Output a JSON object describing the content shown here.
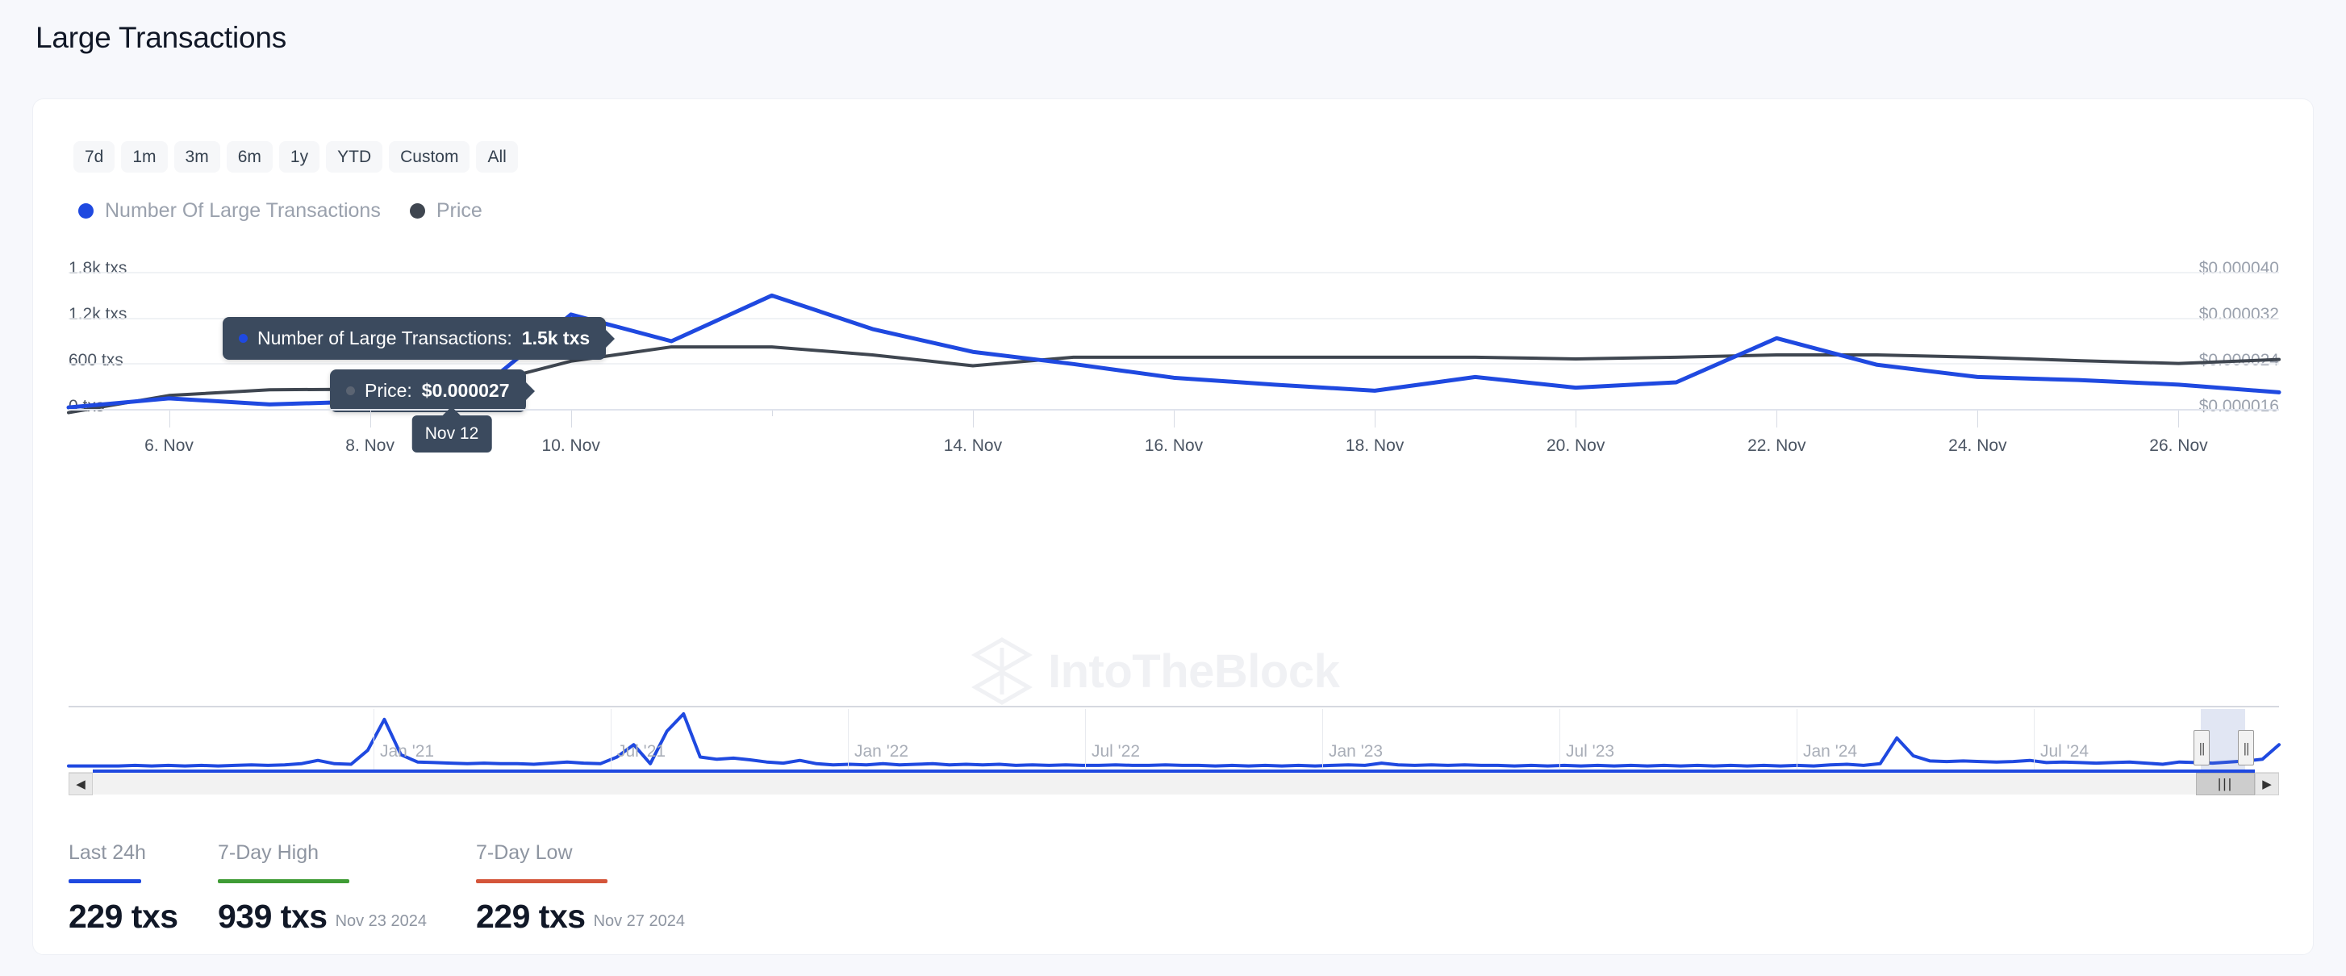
{
  "page_title": "Large Transactions",
  "ranges": [
    {
      "label": "7d",
      "selected": false
    },
    {
      "label": "1m",
      "selected": false
    },
    {
      "label": "3m",
      "selected": false
    },
    {
      "label": "6m",
      "selected": false
    },
    {
      "label": "1y",
      "selected": false
    },
    {
      "label": "YTD",
      "selected": false
    },
    {
      "label": "Custom",
      "selected": false
    },
    {
      "label": "All",
      "selected": false
    }
  ],
  "legend": [
    {
      "label": "Number Of Large Transactions",
      "color": "#1f49e0"
    },
    {
      "label": "Price",
      "color": "#3f4650"
    }
  ],
  "watermark": "IntoTheBlock",
  "tooltips": {
    "series_tip": {
      "prefix": "Number of Large Transactions: ",
      "value": "1.5k txs",
      "color": "#1f49e0"
    },
    "price_tip": {
      "prefix": "Price: ",
      "value": "$0.000027",
      "color": "#3f4650"
    },
    "x_bubble": "Nov 12"
  },
  "stats": [
    {
      "title": "Last 24h",
      "color": "#1f49e0",
      "value": "229 txs",
      "date": ""
    },
    {
      "title": "7-Day High",
      "color": "#3f9c35",
      "value": "939 txs",
      "date": "Nov 23 2024"
    },
    {
      "title": "7-Day Low",
      "color": "#d4553a",
      "value": "229 txs",
      "date": "Nov 27 2024"
    }
  ],
  "navigator": {
    "tick_labels": [
      "Jan '21",
      "Jul '21",
      "Jan '22",
      "Jul '22",
      "Jan '23",
      "Jul '23",
      "Jan '24",
      "Jul '24"
    ],
    "scroll_left_icon": "◀",
    "scroll_right_icon": "▶",
    "thumb_grip": "|||",
    "handle_grip": "||"
  },
  "chart_data": {
    "type": "line",
    "title": "Large Transactions",
    "xlabel": "",
    "ylabel": "txs",
    "y_left_ticks": [
      "0 txs",
      "600 txs",
      "1.2k txs",
      "1.8k txs"
    ],
    "y_left_values": [
      0,
      600,
      1200,
      1800
    ],
    "ylim": [
      0,
      1900
    ],
    "y_right_ticks": [
      "$0.000016",
      "$0.000024",
      "$0.000032",
      "$0.000040"
    ],
    "y_right_values": [
      1.6e-05,
      2.4e-05,
      3.2e-05,
      4e-05
    ],
    "y2lim": [
      1.35e-05,
      4.25e-05
    ],
    "x_tick_labels": [
      "6. Nov",
      "8. Nov",
      "10. Nov",
      "14. Nov",
      "16. Nov",
      "18. Nov",
      "20. Nov",
      "22. Nov",
      "24. Nov",
      "26. Nov"
    ],
    "grid": true,
    "legend_position": "top-left",
    "x": [
      "5. Nov",
      "6. Nov",
      "7. Nov",
      "8. Nov",
      "9. Nov",
      "10. Nov",
      "11. Nov",
      "12. Nov",
      "13. Nov",
      "14. Nov",
      "15. Nov",
      "16. Nov",
      "17. Nov",
      "18. Nov",
      "19. Nov",
      "20. Nov",
      "21. Nov",
      "22. Nov",
      "23. Nov",
      "24. Nov",
      "25. Nov",
      "26. Nov",
      "27. Nov"
    ],
    "series": [
      {
        "name": "Number Of Large Transactions",
        "color": "#1f49e0",
        "axis": "left",
        "unit": "txs",
        "values": [
          30,
          150,
          70,
          110,
          170,
          1250,
          900,
          1500,
          1060,
          760,
          600,
          420,
          330,
          250,
          430,
          290,
          360,
          939,
          590,
          430,
          390,
          330,
          229
        ]
      },
      {
        "name": "Price",
        "color": "#3f4650",
        "axis": "right",
        "unit": "$",
        "values": [
          1.55e-05,
          1.85e-05,
          1.95e-05,
          1.96e-05,
          2e-05,
          2.45e-05,
          2.7e-05,
          2.7e-05,
          2.56e-05,
          2.37e-05,
          2.52e-05,
          2.52e-05,
          2.52e-05,
          2.52e-05,
          2.52e-05,
          2.49e-05,
          2.52e-05,
          2.56e-05,
          2.56e-05,
          2.52e-05,
          2.46e-05,
          2.41e-05,
          2.48e-05
        ]
      }
    ],
    "navigator_series": {
      "name": "Number Of Large Transactions",
      "color": "#1f49e0",
      "values": [
        2,
        2,
        2,
        2,
        3,
        2,
        3,
        2,
        3,
        2,
        3,
        4,
        3,
        4,
        6,
        12,
        6,
        5,
        30,
        85,
        22,
        9,
        8,
        7,
        6,
        7,
        6,
        6,
        5,
        7,
        9,
        7,
        6,
        18,
        40,
        6,
        64,
        95,
        18,
        14,
        16,
        13,
        9,
        7,
        12,
        6,
        4,
        5,
        4,
        6,
        4,
        5,
        6,
        4,
        5,
        4,
        5,
        3,
        4,
        3,
        4,
        3,
        3,
        4,
        3,
        3,
        4,
        3,
        3,
        2,
        3,
        2,
        3,
        2,
        3,
        2,
        3,
        4,
        3,
        7,
        4,
        3,
        4,
        3,
        4,
        3,
        3,
        2,
        3,
        2,
        3,
        2,
        3,
        2,
        3,
        2,
        3,
        2,
        3,
        2,
        3,
        2,
        3,
        2,
        3,
        2,
        4,
        5,
        3,
        6,
        52,
        20,
        11,
        10,
        11,
        10,
        9,
        10,
        12,
        8,
        9,
        8,
        7,
        8,
        9,
        7,
        5,
        9,
        8,
        7,
        9,
        11,
        14,
        40
      ]
    }
  }
}
